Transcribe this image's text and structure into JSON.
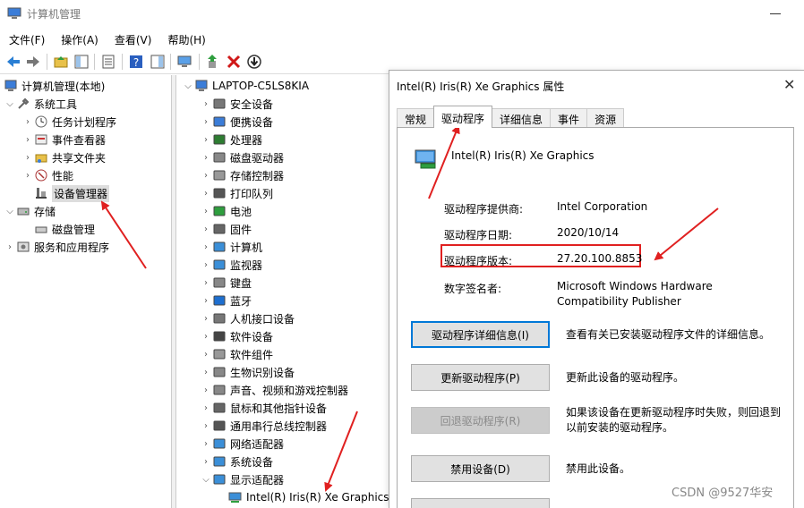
{
  "window": {
    "title": "计算机管理"
  },
  "menu": [
    "文件(F)",
    "操作(A)",
    "查看(V)",
    "帮助(H)"
  ],
  "left_tree": {
    "root": "计算机管理(本地)",
    "system_tools": "系统工具",
    "task_scheduler": "任务计划程序",
    "event_viewer": "事件查看器",
    "shared_folders": "共享文件夹",
    "performance": "性能",
    "device_manager": "设备管理器",
    "storage": "存储",
    "disk_management": "磁盘管理",
    "services_apps": "服务和应用程序"
  },
  "device_tree": {
    "computer_name": "LAPTOP-C5LS8KIA",
    "categories": [
      "安全设备",
      "便携设备",
      "处理器",
      "磁盘驱动器",
      "存储控制器",
      "打印队列",
      "电池",
      "固件",
      "计算机",
      "监视器",
      "键盘",
      "蓝牙",
      "人机接口设备",
      "软件设备",
      "软件组件",
      "生物识别设备",
      "声音、视频和游戏控制器",
      "鼠标和其他指针设备",
      "通用串行总线控制器",
      "网络适配器",
      "系统设备",
      "显示适配器"
    ],
    "selected_device": "Intel(R) Iris(R) Xe Graphics"
  },
  "dialog": {
    "title": "Intel(R) Iris(R) Xe Graphics 属性",
    "tabs": [
      "常规",
      "驱动程序",
      "详细信息",
      "事件",
      "资源"
    ],
    "device_name": "Intel(R) Iris(R) Xe Graphics",
    "provider_label": "驱动程序提供商:",
    "provider_value": "Intel Corporation",
    "date_label": "驱动程序日期:",
    "date_value": "2020/10/14",
    "version_label": "驱动程序版本:",
    "version_value": "27.20.100.8853",
    "signer_label": "数字签名者:",
    "signer_value_line1": "Microsoft Windows Hardware",
    "signer_value_line2": "Compatibility Publisher",
    "btn_details": "驱动程序详细信息(I)",
    "btn_details_desc": "查看有关已安装驱动程序文件的详细信息。",
    "btn_update": "更新驱动程序(P)",
    "btn_update_desc": "更新此设备的驱动程序。",
    "btn_rollback": "回退驱动程序(R)",
    "btn_rollback_desc_line1": "如果该设备在更新驱动程序时失败，则回退到",
    "btn_rollback_desc_line2": "以前安装的驱动程序。",
    "btn_disable": "禁用设备(D)",
    "btn_disable_desc": "禁用此设备。"
  },
  "watermark": "CSDN @9527华安",
  "colors": {
    "annotation": "#e02020",
    "accent": "#0078d7"
  }
}
